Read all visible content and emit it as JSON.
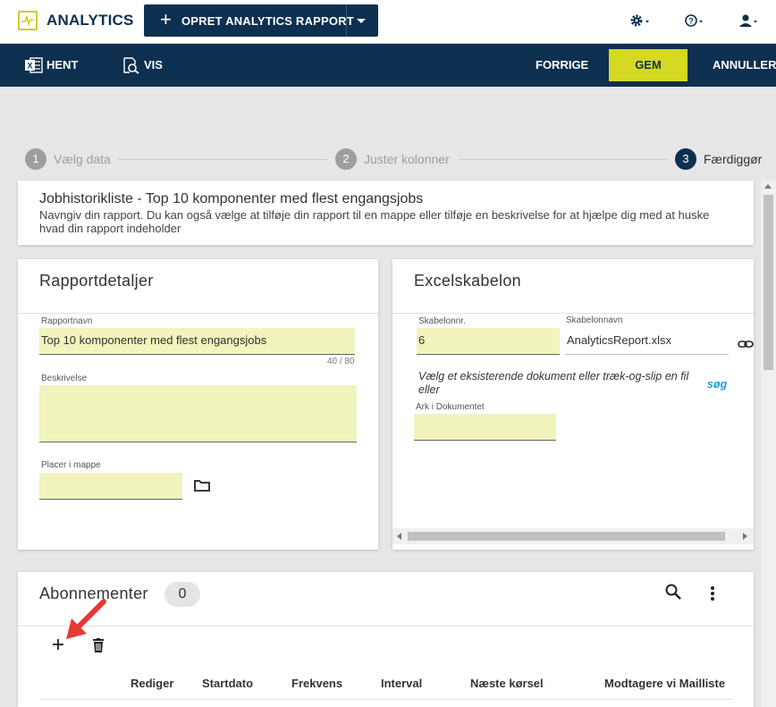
{
  "topbar": {
    "app_title": "ANALYTICS",
    "create_button_label": "OPRET ANALYTICS RAPPORT"
  },
  "actionbar": {
    "hent_label": "HENT",
    "vis_label": "VIS",
    "forrige_label": "FORRIGE",
    "gem_label": "GEM",
    "annuller_label": "ANNULLER"
  },
  "stepper": {
    "steps": [
      {
        "number": "1",
        "label": "Vælg data"
      },
      {
        "number": "2",
        "label": "Juster kolonner"
      },
      {
        "number": "3",
        "label": "Færdiggør"
      }
    ]
  },
  "info": {
    "title": "Jobhistorikliste - Top 10 komponenter med flest engangsjobs",
    "description": "Navngiv din rapport. Du kan også vælge at tilføje din rapport til en mappe eller tilføje en beskrivelse for at hjælpe dig med at huske hvad din rapport indeholder"
  },
  "details": {
    "heading": "Rapportdetaljer",
    "name_label": "Rapportnavn",
    "name_value": "Top 10 komponenter med flest engangsjobs",
    "name_counter": "40 / 80",
    "description_label": "Beskrivelse",
    "description_value": "",
    "folder_label": "Placer i mappe",
    "folder_value": ""
  },
  "excel": {
    "heading": "Excelskabelon",
    "template_no_label": "Skabelonnr.",
    "template_no_value": "6",
    "template_name_label": "Skabelonnavn",
    "template_name_value": "AnalyticsReport.xlsx",
    "hint": "Vælg et eksisterende dokument eller træk-og-slip en fil eller",
    "search_link": "søg",
    "sheet_label": "Ark i Dokumentet",
    "sheet_value": ""
  },
  "subscriptions": {
    "heading": "Abonnementer",
    "count": "0",
    "columns": [
      "Rediger",
      "Startdato",
      "Frekvens",
      "Interval",
      "Næste kørsel",
      "Modtagere vi Mailliste"
    ]
  },
  "colors": {
    "navy": "#0d3050",
    "accent": "#d4d922",
    "field_bg": "#f1f4bd",
    "link": "#1a9fd8",
    "arrow": "#e53935"
  }
}
